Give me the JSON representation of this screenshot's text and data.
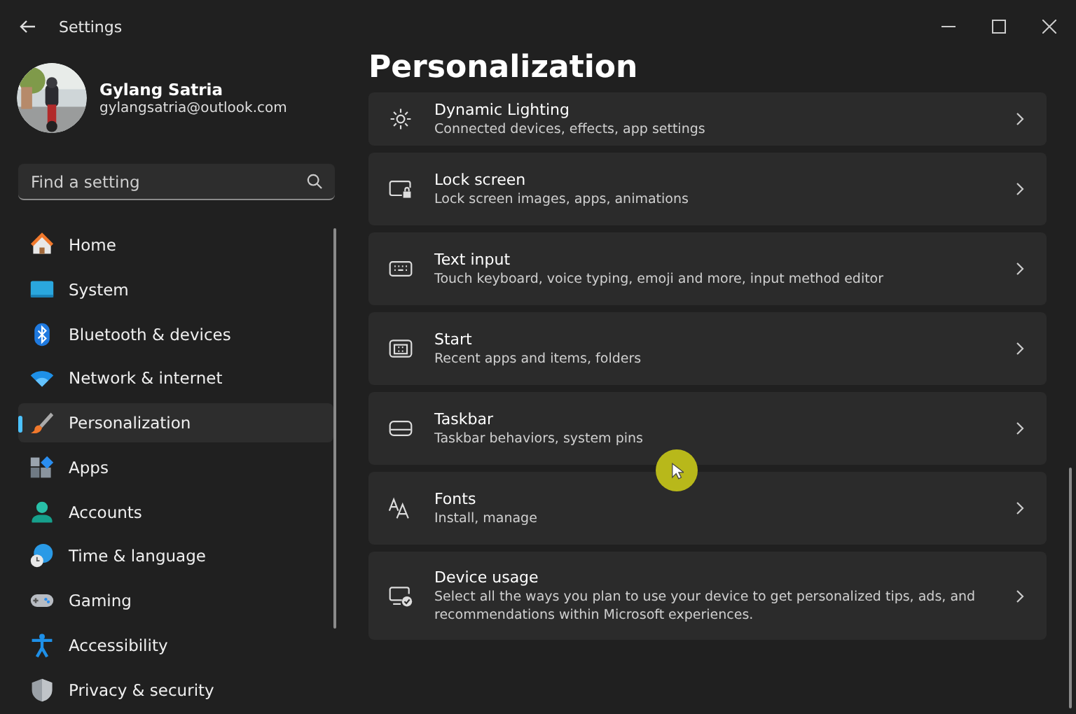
{
  "window": {
    "title": "Settings"
  },
  "user": {
    "name": "Gylang Satria",
    "email": "gylangsatria@outlook.com"
  },
  "search": {
    "placeholder": "Find a setting"
  },
  "nav": [
    {
      "label": "Home",
      "selected": false
    },
    {
      "label": "System",
      "selected": false
    },
    {
      "label": "Bluetooth & devices",
      "selected": false
    },
    {
      "label": "Network & internet",
      "selected": false
    },
    {
      "label": "Personalization",
      "selected": true
    },
    {
      "label": "Apps",
      "selected": false
    },
    {
      "label": "Accounts",
      "selected": false
    },
    {
      "label": "Time & language",
      "selected": false
    },
    {
      "label": "Gaming",
      "selected": false
    },
    {
      "label": "Accessibility",
      "selected": false
    },
    {
      "label": "Privacy & security",
      "selected": false
    }
  ],
  "page_title": "Personalization",
  "cards": [
    {
      "title": "Dynamic Lighting",
      "subtitle": "Connected devices, effects, app settings"
    },
    {
      "title": "Lock screen",
      "subtitle": "Lock screen images, apps, animations"
    },
    {
      "title": "Text input",
      "subtitle": "Touch keyboard, voice typing, emoji and more, input method editor"
    },
    {
      "title": "Start",
      "subtitle": "Recent apps and items, folders"
    },
    {
      "title": "Taskbar",
      "subtitle": "Taskbar behaviors, system pins"
    },
    {
      "title": "Fonts",
      "subtitle": "Install, manage"
    },
    {
      "title": "Device usage",
      "subtitle": "Select all the ways you plan to use your device to get personalized tips, ads, and recommendations within Microsoft experiences."
    }
  ]
}
